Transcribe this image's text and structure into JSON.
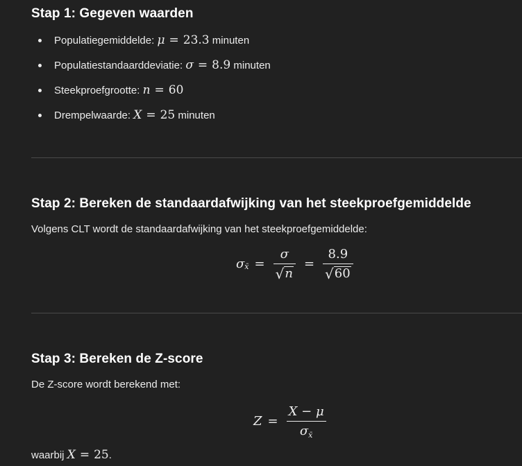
{
  "step1": {
    "title": "Stap 1: Gegeven waarden",
    "items": [
      {
        "label": "Populatiegemiddelde:",
        "var": "μ",
        "op": "=",
        "value": "23.3",
        "unit": "minuten"
      },
      {
        "label": "Populatiestandaarddeviatie:",
        "var": "σ",
        "op": "=",
        "value": "8.9",
        "unit": "minuten"
      },
      {
        "label": "Steekproefgrootte:",
        "var": "n",
        "op": "=",
        "value": "60",
        "unit": ""
      },
      {
        "label": "Drempelwaarde:",
        "var": "X",
        "op": "=",
        "value": "25",
        "unit": "minuten"
      }
    ]
  },
  "step2": {
    "title": "Stap 2: Bereken de standaardafwijking van het steekproefgemiddelde",
    "text": "Volgens CLT wordt de standaardafwijking van het steekproefgemiddelde:",
    "formula": {
      "lhs": "σ",
      "lhs_sub": "x̄",
      "eq": "=",
      "frac1_num": "σ",
      "frac1_den": "n",
      "frac2_num": "8.9",
      "frac2_den": "60"
    }
  },
  "step3": {
    "title": "Stap 3: Bereken de Z-score",
    "text": "De Z-score wordt berekend met:",
    "formula": {
      "lhs": "Z",
      "eq": "=",
      "num": "X − μ",
      "den": "σ",
      "den_sub": "x̄"
    },
    "after_prefix": "waarbij",
    "after_var": "X",
    "after_op": "=",
    "after_value": "25",
    "after_suffix": "."
  }
}
